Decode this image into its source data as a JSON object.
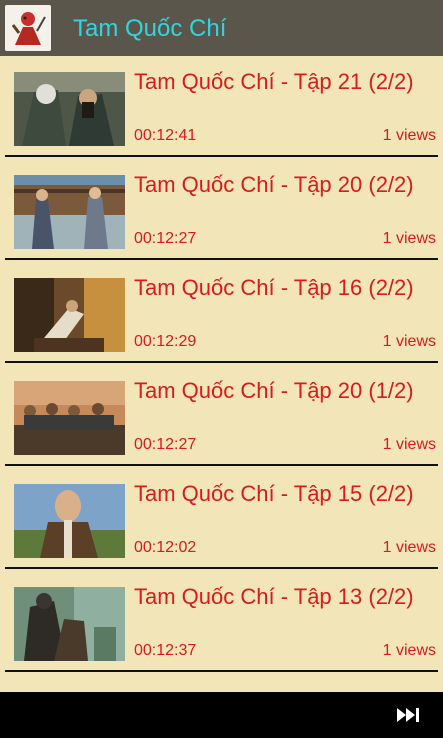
{
  "app": {
    "title": "Tam Quốc Chí"
  },
  "videos": [
    {
      "title": "Tam Quốc Chí - Tập 21 (2/2)",
      "duration": "00:12:41",
      "views": "1 views"
    },
    {
      "title": "Tam Quốc Chí - Tập 20 (2/2)",
      "duration": "00:12:27",
      "views": "1 views"
    },
    {
      "title": "Tam Quốc Chí - Tập 16 (2/2)",
      "duration": "00:12:29",
      "views": "1 views"
    },
    {
      "title": "Tam Quốc Chí - Tập 20 (1/2)",
      "duration": "00:12:27",
      "views": "1 views"
    },
    {
      "title": "Tam Quốc Chí - Tập 15 (2/2)",
      "duration": "00:12:02",
      "views": "1 views"
    },
    {
      "title": "Tam Quốc Chí - Tập 13 (2/2)",
      "duration": "00:12:37",
      "views": "1 views"
    }
  ],
  "appbar": {
    "next_icon": "skip-next-icon"
  },
  "colors": {
    "header_bg": "#5b564b",
    "title_accent": "#35d3dc",
    "list_bg": "#f2e6b8",
    "item_text": "#d91b1b",
    "appbar_bg": "#000000"
  }
}
